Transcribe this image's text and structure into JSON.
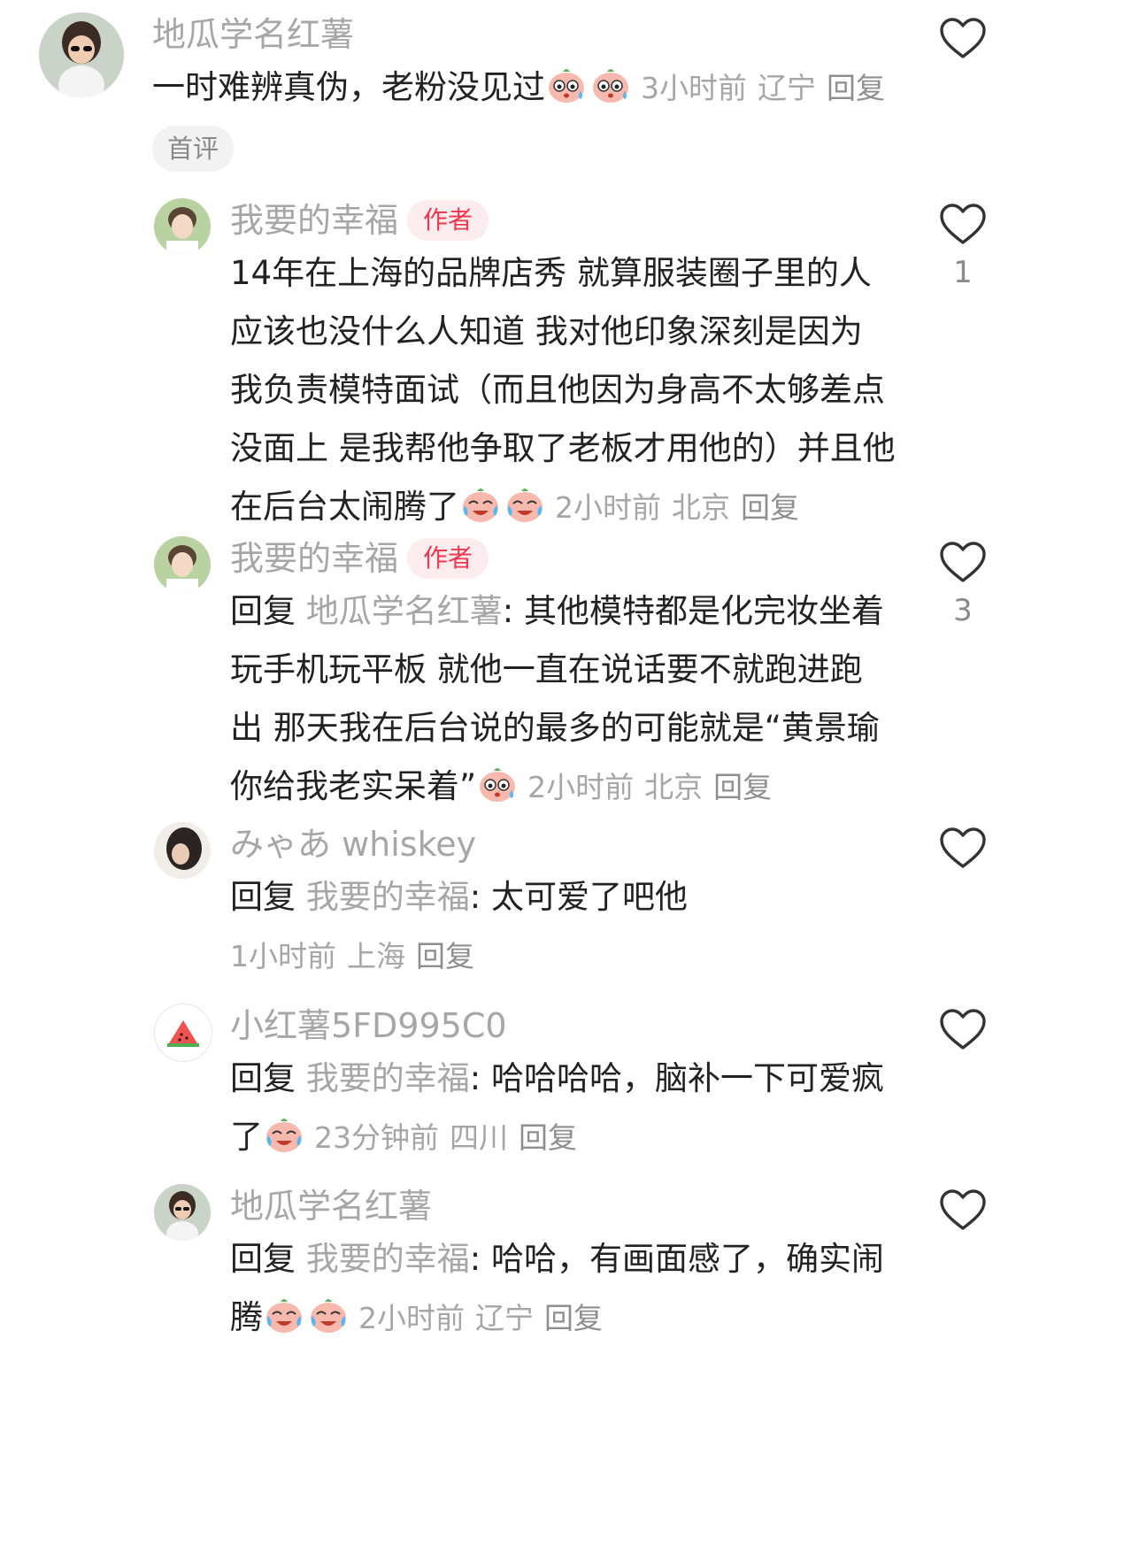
{
  "comments": [
    {
      "user": "地瓜学名红薯",
      "badge": "首评",
      "text": "一时难辨真伪，老粉没见过",
      "emojis": [
        "worried-face",
        "worried-face"
      ],
      "time": "3小时前",
      "location": "辽宁",
      "reply_label": "回复",
      "likes": ""
    },
    {
      "user": "我要的幸福",
      "author_tag": "作者",
      "lines": [
        "14年在上海的品牌店秀 就算服装圈子里的人",
        "应该也没什么人知道 我对他印象深刻是因为",
        "我负责模特面试（而且他因为身高不太够差点",
        "没面上 是我帮他争取了老板才用他的）并且他",
        "在后台太闹腾了"
      ],
      "emojis": [
        "crying-laugh-face",
        "crying-laugh-face"
      ],
      "time": "2小时前",
      "location": "北京",
      "reply_label": "回复",
      "likes": "1"
    },
    {
      "user": "我要的幸福",
      "author_tag": "作者",
      "reply_word": "回复",
      "reply_target": "地瓜学名红薯",
      "lines": [
        ": 其他模特都是化完妆坐着",
        "玩手机玩平板 就他一直在说话要不就跑进跑",
        "出 那天我在后台说的最多的可能就是“黄景瑜",
        "你给我老实呆着”"
      ],
      "emojis": [
        "worried-face"
      ],
      "time": "2小时前",
      "location": "北京",
      "reply_label": "回复",
      "likes": "3"
    },
    {
      "user": "みゃあ whiskey",
      "reply_word": "回复",
      "reply_target": "我要的幸福",
      "lines": [
        ": 太可爱了吧他"
      ],
      "time": "1小时前",
      "location": "上海",
      "reply_label": "回复",
      "likes": ""
    },
    {
      "user": "小红薯5FD995C0",
      "reply_word": "回复",
      "reply_target": "我要的幸福",
      "lines": [
        ": 哈哈哈哈，脑补一下可爱疯",
        "了"
      ],
      "emojis": [
        "crying-laugh-face"
      ],
      "time": "23分钟前",
      "location": "四川",
      "reply_label": "回复",
      "likes": ""
    },
    {
      "user": "地瓜学名红薯",
      "reply_word": "回复",
      "reply_target": "我要的幸福",
      "lines": [
        ": 哈哈，有画面感了，确实闹",
        "腾"
      ],
      "emojis": [
        "crying-laugh-face",
        "crying-laugh-face"
      ],
      "time": "2小时前",
      "location": "辽宁",
      "reply_label": "回复",
      "likes": ""
    }
  ],
  "icons": {
    "like": "heart-outline-icon",
    "worried": "worried-face-emoji",
    "crying": "crying-laugh-face-emoji"
  }
}
